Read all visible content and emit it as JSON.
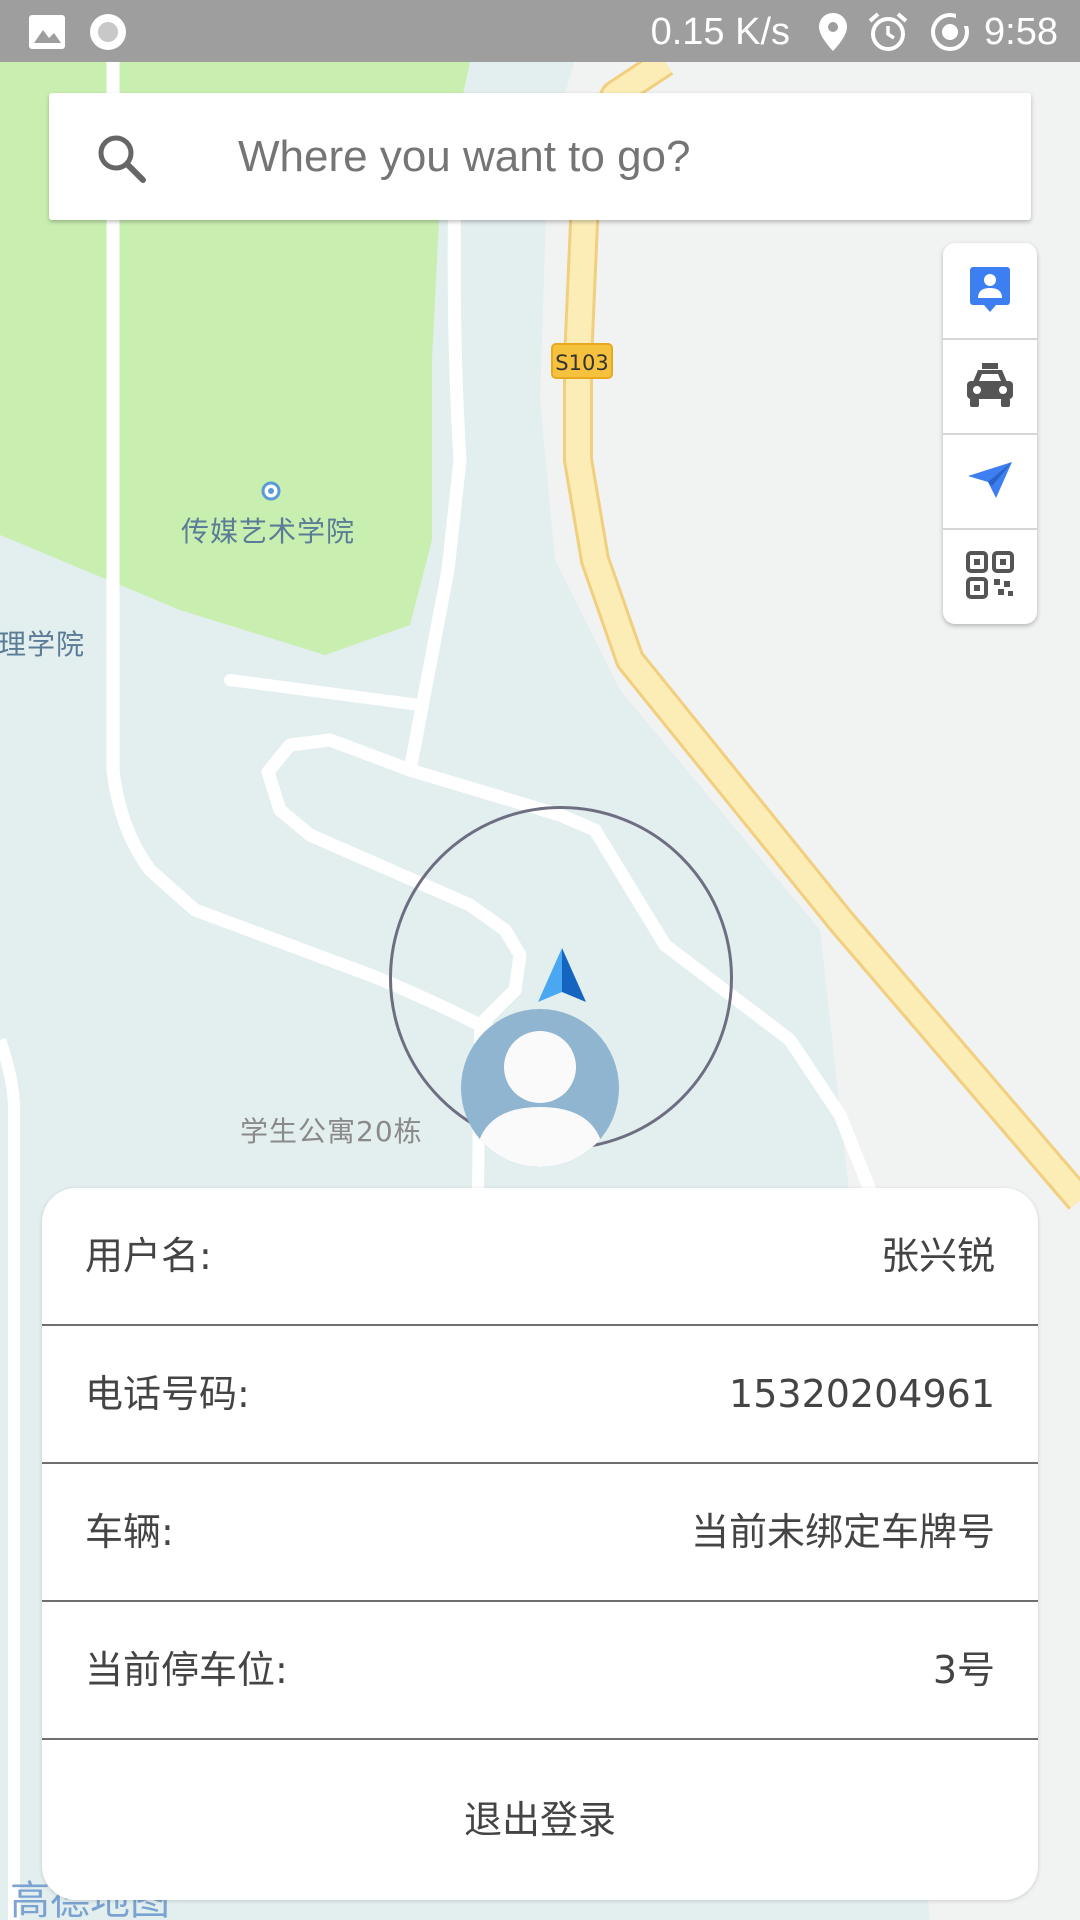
{
  "status_bar": {
    "network_speed": "0.15 K/s",
    "time": "9:58",
    "icons": [
      "image-icon",
      "record-icon",
      "location-icon",
      "alarm-icon",
      "sync-icon"
    ]
  },
  "search": {
    "placeholder": "Where you want to go?",
    "value": ""
  },
  "map": {
    "labels": {
      "poi_media_school": "传媒艺术学院",
      "poi_left_school": "理学院",
      "poi_dorm": "学生公寓20栋",
      "road_shield": "S103"
    },
    "logo_text": "高德地图",
    "colors": {
      "background": "#e3eeee",
      "green_area": "#c9efb0",
      "road": "#ffffff",
      "highway_fill": "#fcedb6",
      "highway_border": "#f2cf7e",
      "shield": "#f6c23e"
    }
  },
  "map_tools": [
    {
      "name": "contact-tool",
      "icon": "contact-card-icon"
    },
    {
      "name": "taxi-tool",
      "icon": "taxi-icon"
    },
    {
      "name": "send-tool",
      "icon": "paper-plane-icon"
    },
    {
      "name": "qrcode-tool",
      "icon": "qr-code-icon"
    }
  ],
  "user_info": {
    "rows": [
      {
        "label": "用户名:",
        "value": "张兴锐"
      },
      {
        "label": "电话号码:",
        "value": "15320204961"
      },
      {
        "label": "车辆:",
        "value": "当前未绑定车牌号"
      },
      {
        "label": "当前停车位:",
        "value": "3号"
      }
    ],
    "logout_label": "退出登录"
  },
  "accent_color": "#3d7ff0"
}
